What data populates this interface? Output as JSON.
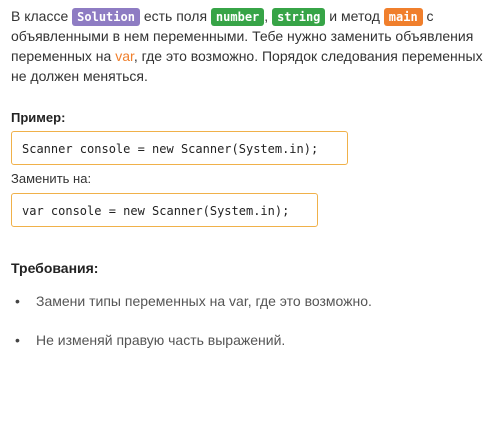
{
  "description": {
    "part1": "В классе ",
    "class_tag": "Solution",
    "part2": " есть поля ",
    "field_tag_1": "number",
    "comma": ", ",
    "field_tag_2": "string",
    "part3": " и метод ",
    "method_tag": "main",
    "part4": " с объявленными в нем переменными. Тебе нужно заменить объявления переменных на ",
    "var_word": "var",
    "part5": ", где это возможно. Порядок следования переменных не должен меняться."
  },
  "example": {
    "heading": "Пример:",
    "code_before": "Scanner console = new Scanner(System.in);",
    "replace_label": "Заменить на:",
    "code_after": "var console = new Scanner(System.in);"
  },
  "requirements": {
    "heading": "Требования:",
    "bullet": "•",
    "items": [
      "Замени типы переменных на var, где это возможно.",
      "Не изменяй правую часть выражений."
    ]
  },
  "colors": {
    "class_tag": "#8e7cc3",
    "field_tag": "#37a447",
    "method_tag": "#f07f2c",
    "code_border": "#f0b14a"
  }
}
